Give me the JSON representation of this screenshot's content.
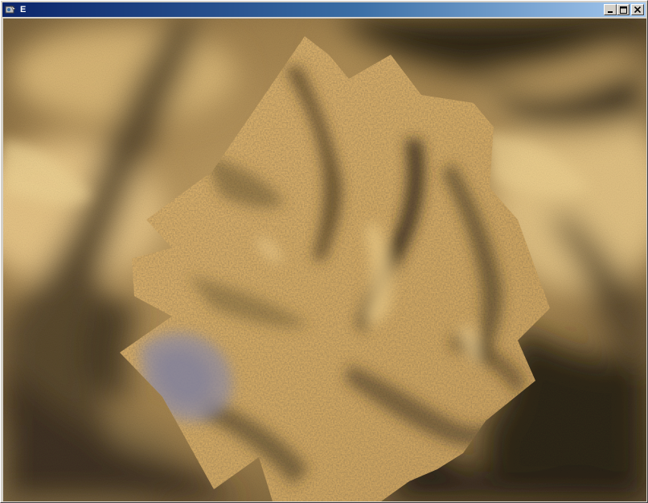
{
  "window": {
    "title": "E",
    "icons": {
      "app": "app-icon",
      "minimize": "minimize-icon",
      "maximize": "maximize-icon",
      "close": "close-icon"
    }
  },
  "scene": {
    "description_colors": {
      "sand": "#d6ad6a",
      "shadow": "#2a2418",
      "water_tint": "#8c8aa0"
    }
  }
}
